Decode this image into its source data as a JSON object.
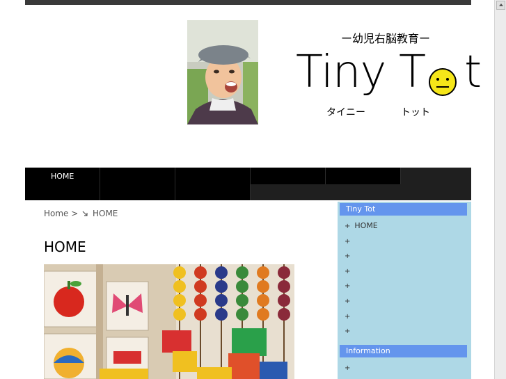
{
  "header": {
    "logo_subtitle": "ー幼児右脳教育ー",
    "logo_text_a": "Tiny",
    "logo_text_b": "T",
    "logo_text_c": "t",
    "logo_kana_a": "タイニー",
    "logo_kana_b": "トット"
  },
  "nav": {
    "items": [
      {
        "label": "HOME"
      },
      {
        "label": ""
      },
      {
        "label": ""
      },
      {
        "label": ""
      },
      {
        "label": ""
      }
    ]
  },
  "breadcrumb": {
    "home": "Home",
    "separator": ">",
    "current": "HOME"
  },
  "main": {
    "title": "HOME"
  },
  "sidebar": {
    "section1_title": "Tiny Tot",
    "section1_items": [
      "HOME",
      "",
      "",
      "",
      "",
      "",
      "",
      ""
    ],
    "section2_title": "Information",
    "section2_items": [
      ""
    ],
    "bullet": "+"
  },
  "colors": {
    "nav_bg": "#000000",
    "sidebar_bg": "#aed8e6",
    "sidebar_heading_bg": "#6495ed",
    "smiley_fill": "#f5e619"
  }
}
